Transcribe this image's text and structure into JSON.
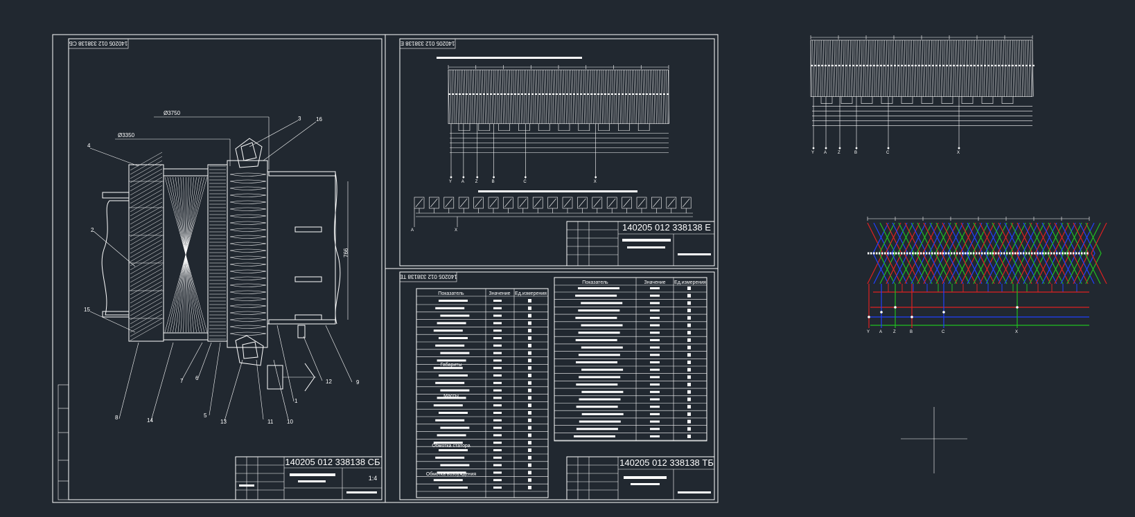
{
  "colors": {
    "background": "#212830",
    "line": "#ffffff",
    "phase_red": "#e02020",
    "phase_green": "#20c020",
    "phase_blue": "#2040ff"
  },
  "sheet_sb": {
    "stamp_rotated": "140205 012 338138 СБ",
    "code": "140205 012 338138 СБ",
    "scale": "1:4",
    "dim_outer": "Ø3750",
    "dim_inner": "Ø3350",
    "dim_height": "766",
    "callouts": [
      "1",
      "2",
      "3",
      "4",
      "5",
      "6",
      "7",
      "8",
      "9",
      "10",
      "11",
      "12",
      "13",
      "14",
      "15",
      "16"
    ]
  },
  "sheet_e": {
    "stamp_rotated": "140205 012 338138 Е",
    "code": "140205 012 338138 Е",
    "terminal_labels": [
      "Y",
      "A",
      "Z",
      "B",
      "C",
      "X"
    ],
    "pole_terminals": [
      "A",
      "X"
    ]
  },
  "sheet_tb": {
    "stamp_rotated": "140205 012 338138 ТБ",
    "code": "140205 012 338138 ТБ",
    "table1_headers": [
      "Показатель",
      "Значение",
      "Ед.измерения"
    ],
    "table2_headers": [
      "Показатель",
      "Значение",
      "Ед.измерения"
    ],
    "section_labels": [
      "Габариты",
      "Массы",
      "Обмотка статора",
      "Обмотка возбуждения"
    ]
  },
  "extra_diagrams": {
    "terminal_labels": [
      "Y",
      "A",
      "Z",
      "B",
      "C",
      "X"
    ]
  }
}
